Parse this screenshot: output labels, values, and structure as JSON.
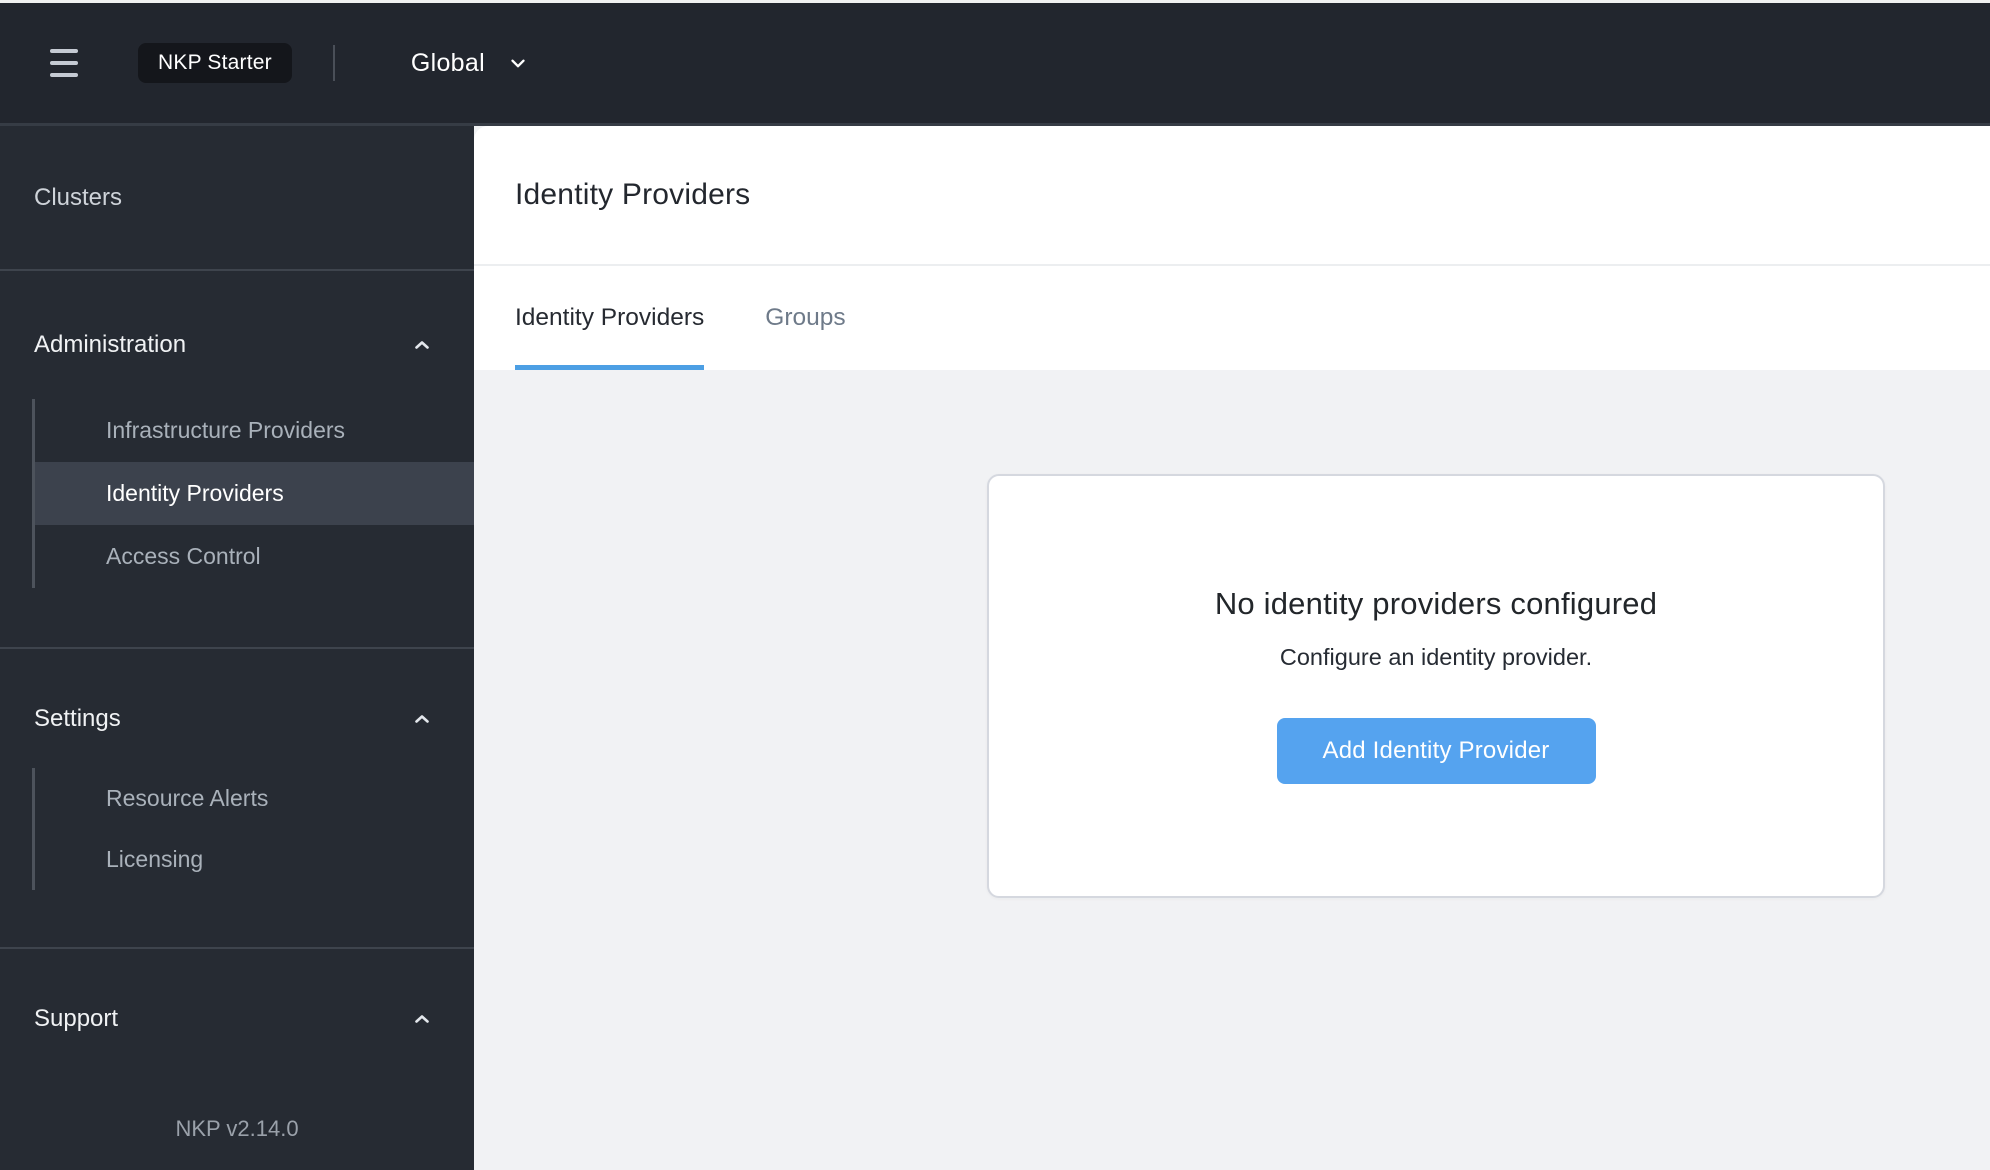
{
  "topbar": {
    "badge": "NKP Starter",
    "scope": "Global"
  },
  "sidebar": {
    "clusters_label": "Clusters",
    "sections": [
      {
        "label": "Administration",
        "expanded": true,
        "children": [
          {
            "label": "Infrastructure Providers",
            "selected": false
          },
          {
            "label": "Identity Providers",
            "selected": true
          },
          {
            "label": "Access Control",
            "selected": false
          }
        ]
      },
      {
        "label": "Settings",
        "expanded": true,
        "children": [
          {
            "label": "Resource Alerts",
            "selected": false
          },
          {
            "label": "Licensing",
            "selected": false
          }
        ]
      },
      {
        "label": "Support",
        "expanded": true,
        "children": []
      }
    ],
    "version": "NKP v2.14.0"
  },
  "main": {
    "title": "Identity Providers",
    "tabs": [
      {
        "label": "Identity Providers",
        "active": true
      },
      {
        "label": "Groups",
        "active": false
      }
    ],
    "empty_state": {
      "title": "No identity providers configured",
      "subtitle": "Configure an identity provider.",
      "button": "Add Identity Provider"
    }
  },
  "colors": {
    "topbar_bg": "#22262e",
    "sidebar_bg": "#262b33",
    "selected_item_bg": "#3c424d",
    "accent_blue_button": "#55a3ef",
    "accent_blue_underline": "#4c9fe4",
    "content_bg": "#f1f2f4",
    "card_border": "#d5d8df"
  }
}
